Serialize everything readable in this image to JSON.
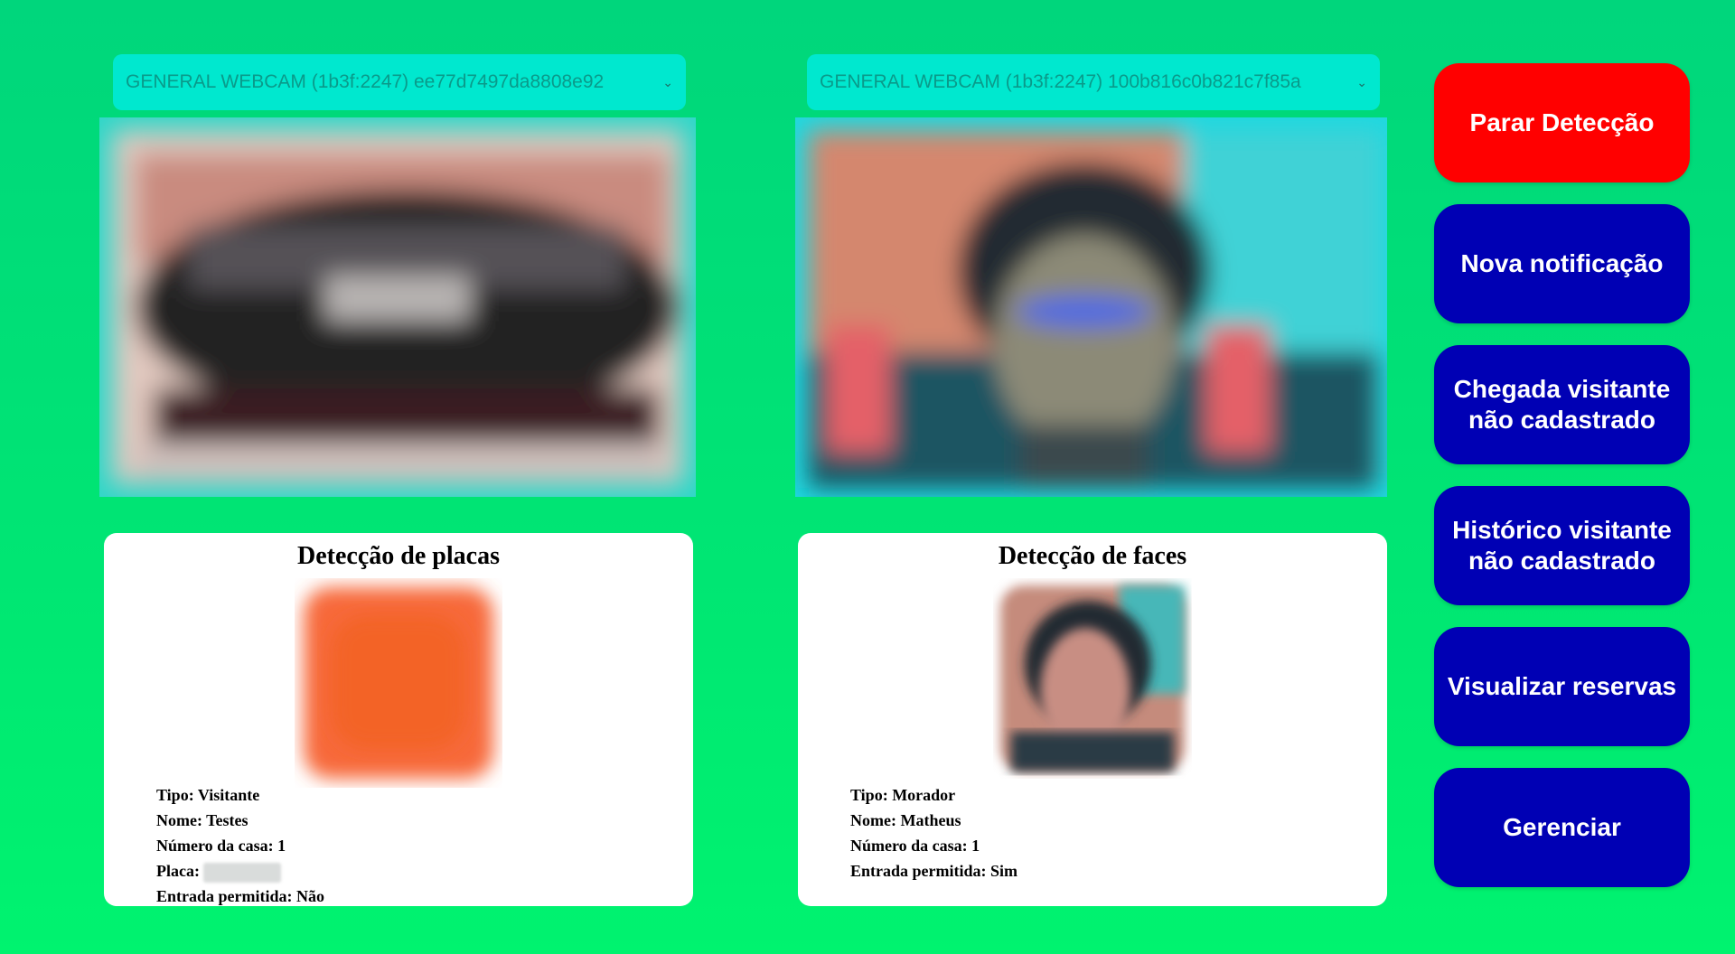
{
  "cameras": [
    {
      "selected_option": "GENERAL WEBCAM (1b3f:2247) ee77d7497da8808e92"
    },
    {
      "selected_option": "GENERAL WEBCAM (1b3f:2247) 100b816c0b821c7f85a"
    }
  ],
  "plate_panel": {
    "title": "Detecção de placas",
    "fields": [
      {
        "label": "Tipo:",
        "value": "Visitante"
      },
      {
        "label": "Nome:",
        "value": "Testes"
      },
      {
        "label": "Número da casa:",
        "value": "1"
      },
      {
        "label": "Placa:",
        "value": ""
      },
      {
        "label": "Entrada permitida:",
        "value": "Não"
      }
    ]
  },
  "face_panel": {
    "title": "Detecção de faces",
    "fields": [
      {
        "label": "Tipo:",
        "value": "Morador"
      },
      {
        "label": "Nome:",
        "value": "Matheus"
      },
      {
        "label": "Número da casa:",
        "value": "1"
      },
      {
        "label": "Entrada permitida:",
        "value": "Sim"
      }
    ]
  },
  "actions": {
    "stop_detection": "Parar Detecção",
    "new_notification": "Nova notificação",
    "unregistered_arrival": "Chegada visitante não cadastrado",
    "unregistered_history": "Histórico visitante não cadastrado",
    "view_reservations": "Visualizar reservas",
    "manage": "Gerenciar"
  },
  "colors": {
    "stop_button": "#ff0000",
    "action_button": "#0000b4",
    "select_background": "#00e8cf"
  }
}
